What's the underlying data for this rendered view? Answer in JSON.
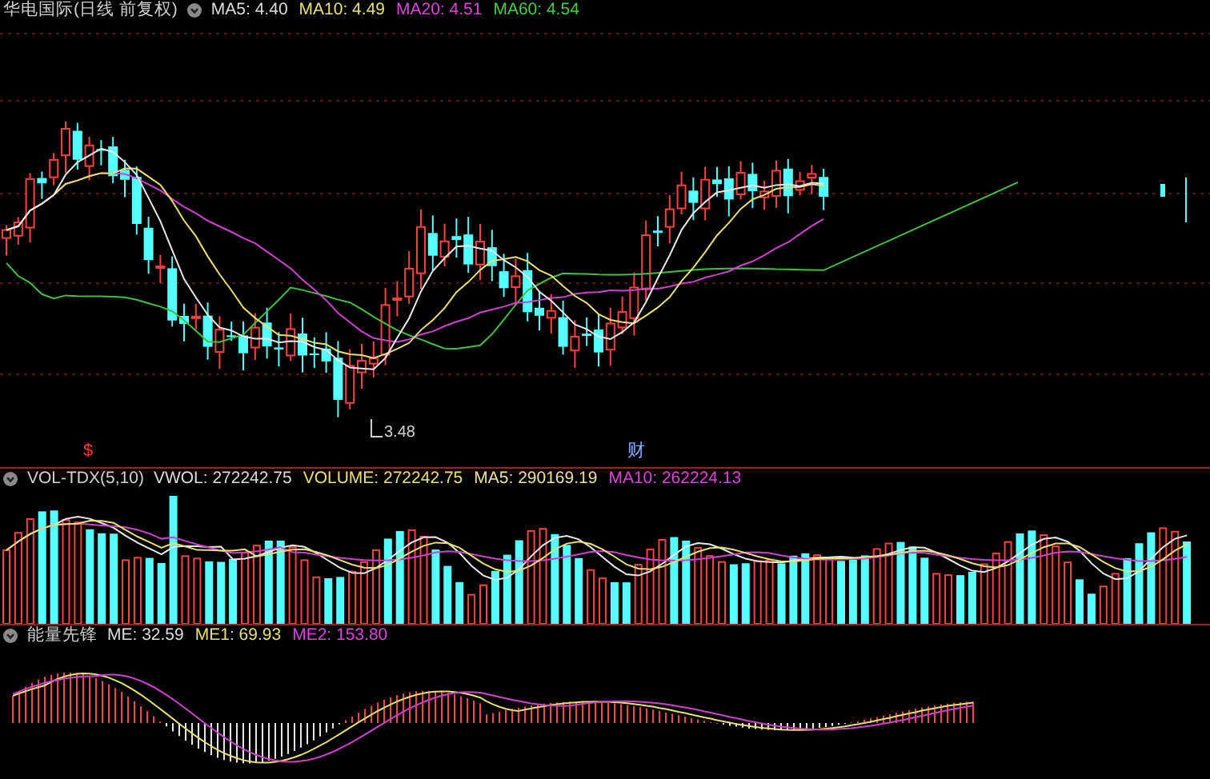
{
  "main_panel": {
    "title": "华电国际(日线 前复权)",
    "indicators": [
      {
        "label": "MA5: 4.40",
        "color": "#dcdcdc"
      },
      {
        "label": "MA10: 4.49",
        "color": "#e8e070"
      },
      {
        "label": "MA20: 4.51",
        "color": "#e040e0"
      },
      {
        "label": "MA60: 4.54",
        "color": "#40d040"
      }
    ],
    "low_label": "3.48",
    "markers": [
      {
        "text": "$",
        "color": "#ff3030"
      },
      {
        "text": "财",
        "color": "#7fb0ff"
      }
    ]
  },
  "volume_panel": {
    "title": "VOL-TDX(5,10)",
    "indicators": [
      {
        "label": "VWOL: 272242.75",
        "color": "#dcdcdc"
      },
      {
        "label": "VOLUME: 272242.75",
        "color": "#e8e070"
      },
      {
        "label": "MA5: 290169.19",
        "color": "#e8e0a0"
      },
      {
        "label": "MA10: 262224.13",
        "color": "#e040e0"
      }
    ]
  },
  "energy_panel": {
    "title": "能量先锋",
    "indicators": [
      {
        "label": "ME: 32.59",
        "color": "#dcdcdc"
      },
      {
        "label": "ME1: 69.93",
        "color": "#e8e070"
      },
      {
        "label": "ME2: 153.80",
        "color": "#e040e0"
      }
    ]
  }
}
